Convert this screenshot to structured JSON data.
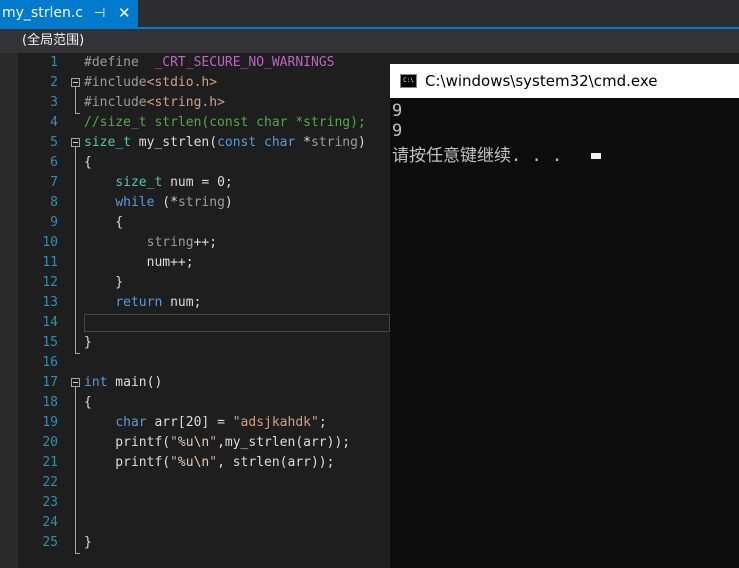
{
  "tab": {
    "title": "my_strlen.c",
    "pin": "⊣",
    "close": "✕"
  },
  "scope": {
    "label": "(全局范围)"
  },
  "editor": {
    "line_numbers": [
      "1",
      "2",
      "3",
      "4",
      "5",
      "6",
      "7",
      "8",
      "9",
      "10",
      "11",
      "12",
      "13",
      "14",
      "15",
      "16",
      "17",
      "18",
      "19",
      "20",
      "21",
      "22",
      "23",
      "24",
      "25"
    ],
    "tokens": {
      "l1_a": "#define",
      "l1_b": "  ",
      "l1_c": "_CRT_SECURE_NO_WARNINGS",
      "l2_a": "#include",
      "l2_b": "<stdio.h>",
      "l3_a": "#include",
      "l3_b": "<string.h>",
      "l4": "//size_t strlen(const char *string);",
      "l5_a": "size_t",
      "l5_b": " my_strlen(",
      "l5_c": "const",
      "l5_d": " ",
      "l5_e": "char",
      "l5_f": " *",
      "l5_g": "string",
      "l5_h": ")",
      "l6": "{",
      "l7_a": "    ",
      "l7_b": "size_t",
      "l7_c": " num = 0;",
      "l8_a": "    ",
      "l8_b": "while",
      "l8_c": " (*",
      "l8_d": "string",
      "l8_e": ")",
      "l9": "    {",
      "l10_a": "        ",
      "l10_b": "string",
      "l10_c": "++;",
      "l11": "        num++;",
      "l12": "    }",
      "l13_a": "    ",
      "l13_b": "return",
      "l13_c": " num;",
      "l15": "}",
      "l17_a": "int",
      "l17_b": " main()",
      "l18": "{",
      "l19_a": "    ",
      "l19_b": "char",
      "l19_c": " arr[20] = ",
      "l19_d": "\"adsjkahdk\"",
      "l19_e": ";",
      "l20_a": "    printf(",
      "l20_b": "\"",
      "l20_c": "%u\\n",
      "l20_d": "\"",
      "l20_e": ",my_strlen(arr));",
      "l21_a": "    printf(",
      "l21_b": "\"",
      "l21_c": "%u\\n",
      "l21_d": "\"",
      "l21_e": ", strlen(arr));",
      "l25": "}"
    }
  },
  "console": {
    "title": "C:\\windows\\system32\\cmd.exe",
    "icon_text": "C:\\",
    "lines": [
      "9",
      "9",
      "请按任意键继续. . . "
    ]
  },
  "colors": {
    "tab_accent": "#007acc",
    "keyword": "#569cd6",
    "type": "#4ec9b0",
    "string": "#d69d85",
    "comment": "#57a64a",
    "macro": "#bd63c5",
    "line_number": "#2b91af"
  }
}
